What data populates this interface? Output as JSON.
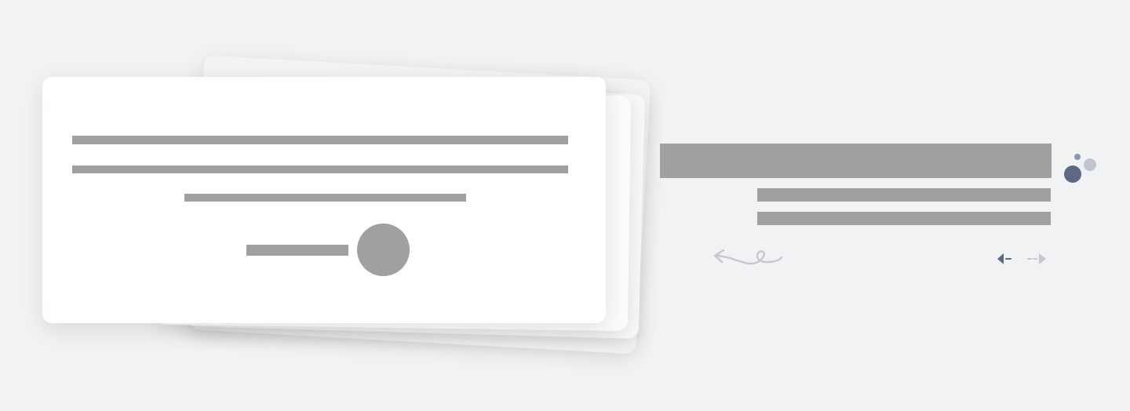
{
  "page": {
    "background": "#f1f2f4"
  },
  "testimonial_card": {
    "quote_lines": [
      "",
      "",
      ""
    ],
    "author_name": "",
    "avatar_label": ""
  },
  "section": {
    "title": "",
    "subtitle_lines": [
      "",
      ""
    ]
  },
  "decor": {
    "dot_colors": [
      "#5b6a84",
      "#bfc5d0",
      "#8d97aa"
    ],
    "swoosh_icon": "swoosh-arrow-icon"
  },
  "nav": {
    "prev_icon": "arrow-left-icon",
    "next_icon": "arrow-right-icon",
    "active_color": "#5b6a84",
    "inactive_color": "#c3c8d1"
  }
}
